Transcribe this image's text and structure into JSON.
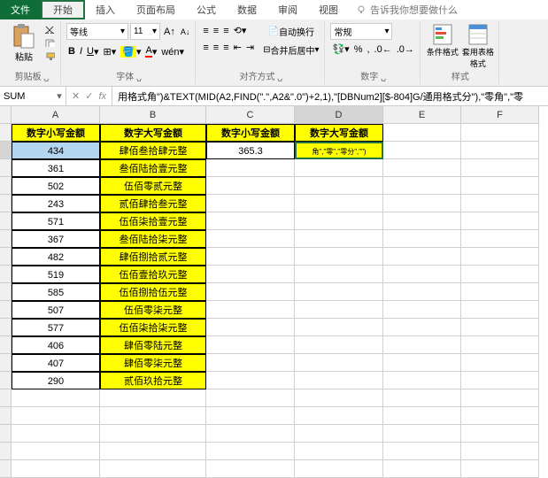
{
  "tabs": {
    "file": "文件",
    "home": "开始",
    "insert": "插入",
    "layout": "页面布局",
    "formulas": "公式",
    "data": "数据",
    "review": "审阅",
    "view": "视图",
    "tell": "告诉我你想要做什么"
  },
  "ribbon": {
    "clipboard": "剪贴板",
    "paste": "粘贴",
    "font": "字体",
    "font_name": "等线",
    "font_size": "11",
    "align": "对齐方式",
    "wrap": "自动换行",
    "merge": "合并后居中",
    "number": "数字",
    "num_format": "常规",
    "styles": "样式",
    "cond": "条件格式",
    "table": "套用表格格式"
  },
  "fbar": {
    "name": "SUM",
    "formula": "用格式角\")&TEXT(MID(A2,FIND(\".\",A2&\".0\")+2,1),\"[DBNum2][$-804]G/通用格式分\"),\"零角\",\"零"
  },
  "cols": [
    "A",
    "B",
    "C",
    "D",
    "E",
    "F"
  ],
  "headers": {
    "a": "数字小写金额",
    "b": "数字大写金额",
    "c": "数字小写金额",
    "d": "数字大写金额"
  },
  "data": [
    {
      "a": "434",
      "b": "肆佰叁拾肆元整",
      "c": "365.3",
      "d": "角\",\"零\",\"零分\",\"\")"
    },
    {
      "a": "361",
      "b": "叁佰陆拾壹元整"
    },
    {
      "a": "502",
      "b": "伍佰零贰元整"
    },
    {
      "a": "243",
      "b": "贰佰肆拾叁元整"
    },
    {
      "a": "571",
      "b": "伍佰柒拾壹元整"
    },
    {
      "a": "367",
      "b": "叁佰陆拾柒元整"
    },
    {
      "a": "482",
      "b": "肆佰捌拾贰元整"
    },
    {
      "a": "519",
      "b": "伍佰壹拾玖元整"
    },
    {
      "a": "585",
      "b": "伍佰捌拾伍元整"
    },
    {
      "a": "507",
      "b": "伍佰零柒元整"
    },
    {
      "a": "577",
      "b": "伍佰柒拾柒元整"
    },
    {
      "a": "406",
      "b": "肆佰零陆元整"
    },
    {
      "a": "407",
      "b": "肆佰零柒元整"
    },
    {
      "a": "290",
      "b": "贰佰玖拾元整"
    }
  ]
}
